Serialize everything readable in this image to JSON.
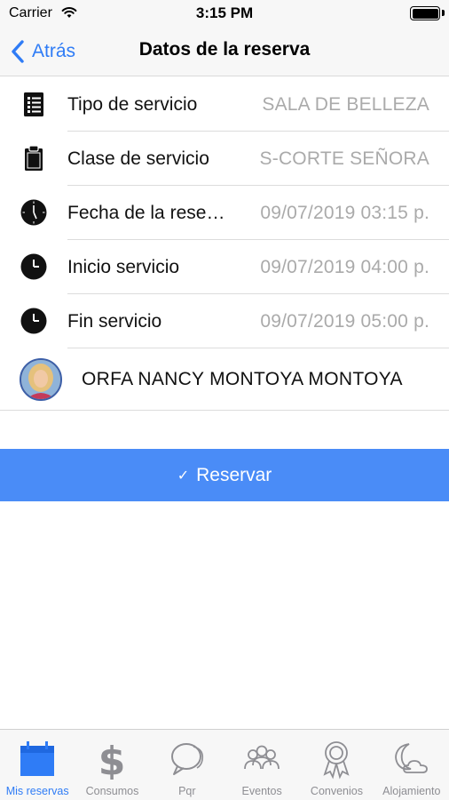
{
  "status_bar": {
    "carrier": "Carrier",
    "time": "3:15 PM",
    "battery_level": 1.0
  },
  "nav": {
    "back_label": "Atrás",
    "title": "Datos de la reserva"
  },
  "details": [
    {
      "icon": "document-list-icon",
      "label": "Tipo de servicio",
      "value": "SALA DE BELLEZA"
    },
    {
      "icon": "clipboard-icon",
      "label": "Clase de servicio",
      "value": "S-CORTE SEÑORA"
    },
    {
      "icon": "clock-icon",
      "label": "Fecha de la reserva",
      "value": "09/07/2019 03:15 p."
    },
    {
      "icon": "clock-icon",
      "label": "Inicio servicio",
      "value": "09/07/2019 04:00 p."
    },
    {
      "icon": "clock-icon",
      "label": "Fin servicio",
      "value": "09/07/2019 05:00 p."
    }
  ],
  "stylist": {
    "name": "ORFA NANCY MONTOYA MONTOYA"
  },
  "reserve_button": {
    "label": "Reservar",
    "icon": "checkmark-icon"
  },
  "tabs": [
    {
      "label": "Mis reservas",
      "icon": "calendar-icon",
      "active": true
    },
    {
      "label": "Consumos",
      "icon": "dollar-icon",
      "active": false
    },
    {
      "label": "Pqr",
      "icon": "chat-bubbles-icon",
      "active": false
    },
    {
      "label": "Eventos",
      "icon": "people-group-icon",
      "active": false
    },
    {
      "label": "Convenios",
      "icon": "award-ribbon-icon",
      "active": false
    },
    {
      "label": "Alojamiento",
      "icon": "moon-cloud-icon",
      "active": false
    }
  ],
  "colors": {
    "accent": "#2f7cf6",
    "button": "#4a8cf7",
    "value_text": "#aaaaaa",
    "tab_inactive": "#8e8e93"
  }
}
